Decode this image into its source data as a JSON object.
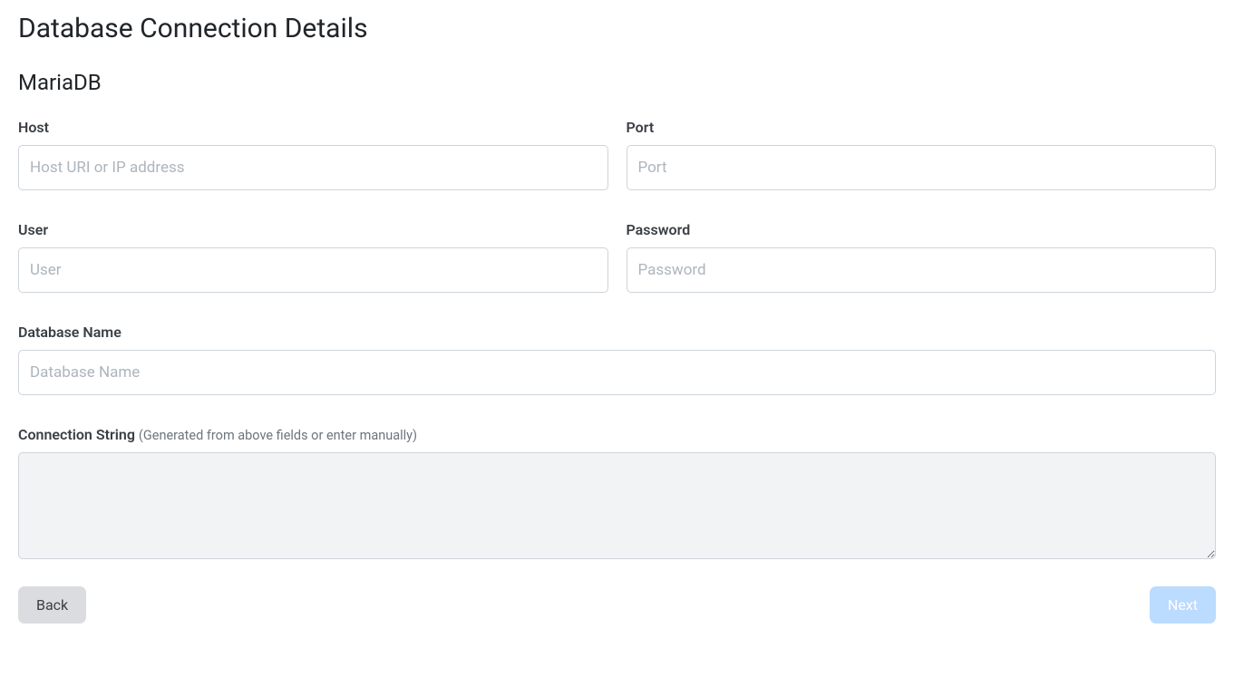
{
  "page": {
    "title": "Database Connection Details",
    "subtitle": "MariaDB"
  },
  "fields": {
    "host": {
      "label": "Host",
      "placeholder": "Host URI or IP address",
      "value": ""
    },
    "port": {
      "label": "Port",
      "placeholder": "Port",
      "value": ""
    },
    "user": {
      "label": "User",
      "placeholder": "User",
      "value": ""
    },
    "password": {
      "label": "Password",
      "placeholder": "Password",
      "value": ""
    },
    "database_name": {
      "label": "Database Name",
      "placeholder": "Database Name",
      "value": ""
    },
    "connection_string": {
      "label": "Connection String",
      "hint": "(Generated from above fields or enter manually)",
      "value": ""
    }
  },
  "buttons": {
    "back": "Back",
    "next": "Next"
  }
}
